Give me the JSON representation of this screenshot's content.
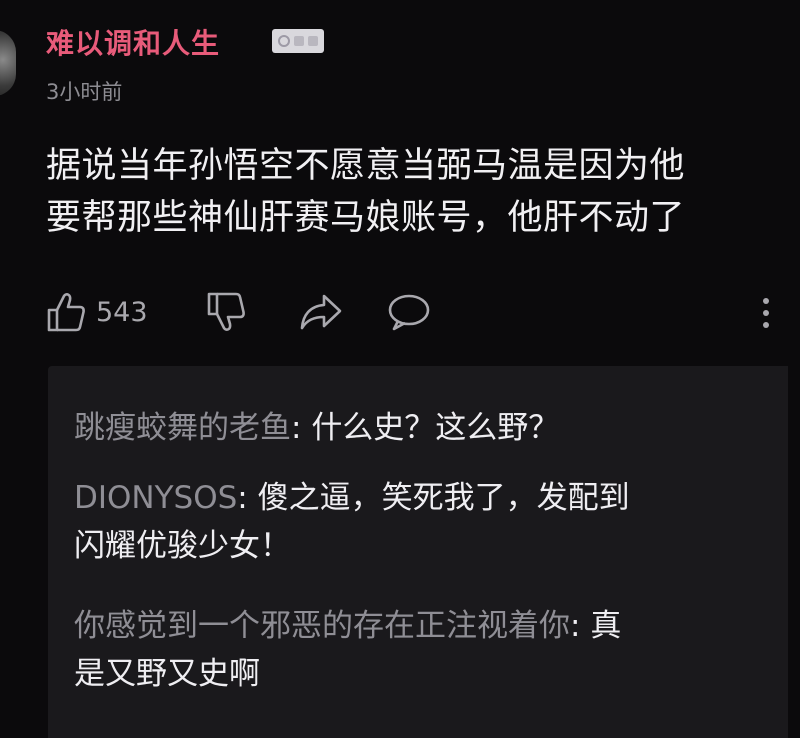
{
  "comment": {
    "username": "难以调和人生",
    "name_color": "#e85b7a",
    "timestamp": "3小时前",
    "text_lines": [
      "据说当年孙悟空不愿意当弼马温是因为他",
      "要帮那些神仙肝赛马娘账号，他肝不动了"
    ],
    "likes": "543",
    "icons": {
      "like": "thumbs-up-icon",
      "dislike": "thumbs-down-icon",
      "share": "share-icon",
      "reply": "comment-bubble-icon",
      "more": "more-vertical-icon"
    }
  },
  "replies": [
    {
      "author": "跳瘦蛟舞的老鱼",
      "separator": ": ",
      "lines": [
        "什么史？这么野？"
      ]
    },
    {
      "author": "DIONYSOS",
      "separator": ": ",
      "lines": [
        "傻之逼，笑死我了，发配到",
        "闪耀优骏少女！"
      ]
    },
    {
      "author": "你感觉到一个邪恶的存在正注视着你",
      "separator": ": ",
      "lines": [
        "真",
        "是又野又史啊"
      ]
    }
  ]
}
